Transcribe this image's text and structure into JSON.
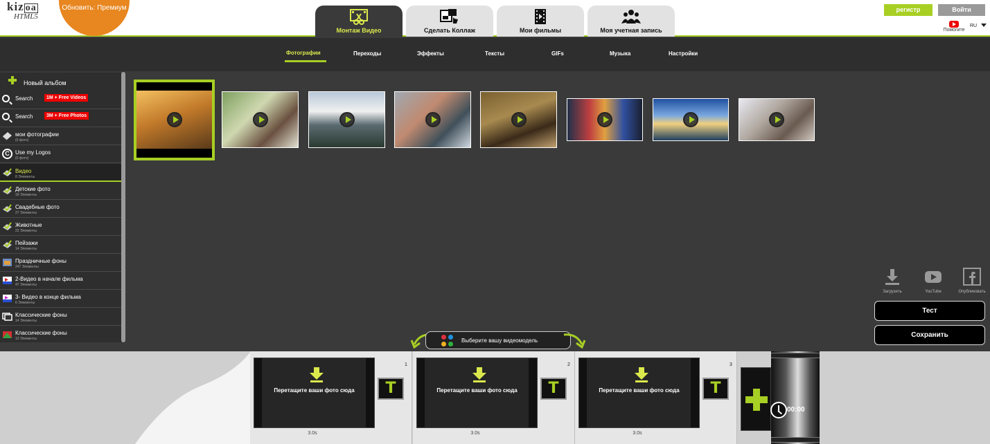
{
  "app": {
    "logo_main": "kizoa",
    "logo_sub": "HTML5",
    "premium_label": "Обновить: Премиум"
  },
  "tabs": [
    {
      "label": "Монтаж Видео",
      "icon": "film-scissors-icon",
      "active": true
    },
    {
      "label": "Сделать Коллаж",
      "icon": "collage-icon",
      "active": false
    },
    {
      "label": "Мои фильмы",
      "icon": "film-icon",
      "active": false
    },
    {
      "label": "Моя учетная запись",
      "icon": "users-icon",
      "active": false
    }
  ],
  "account": {
    "register_label": "регистр",
    "login_label": "Войти",
    "help_label": "Помогите",
    "language": "RU"
  },
  "subtabs": [
    {
      "label": "Фотографии",
      "active": true
    },
    {
      "label": "Переходы",
      "active": false
    },
    {
      "label": "Эффекты",
      "active": false
    },
    {
      "label": "Тексты",
      "active": false
    },
    {
      "label": "GIFs",
      "active": false
    },
    {
      "label": "Музыка",
      "active": false
    },
    {
      "label": "Настройки",
      "active": false
    }
  ],
  "sidebar": {
    "new_album_label": "Новый альбом",
    "items": [
      {
        "label": "Search",
        "badge": "1M + Free Videos",
        "icon": "search-icon"
      },
      {
        "label": "Search",
        "badge": "3M + Free Photos",
        "icon": "search-icon"
      },
      {
        "label": "мои фотографии",
        "count": "(0 фото)",
        "icon": "album-icon"
      },
      {
        "label": "Use my Logos",
        "count": "(0 фото)",
        "icon": "copyright-icon"
      },
      {
        "label": "Видео",
        "count": "8 Элементы",
        "icon": "folder-check-icon",
        "active": true
      },
      {
        "label": "Детские фото",
        "count": "18 Элементы",
        "icon": "folder-check-icon"
      },
      {
        "label": "Свадебные фото",
        "count": "27 Элементы",
        "icon": "folder-check-icon"
      },
      {
        "label": "Животные",
        "count": "22 Элементы",
        "icon": "folder-check-icon"
      },
      {
        "label": "Пейзажи",
        "count": "14 Элементы",
        "icon": "folder-check-icon"
      },
      {
        "label": "Праздничные фоны",
        "count": "247 Элементы",
        "icon": "holiday-icon"
      },
      {
        "label": "2-Видео в начале фильма",
        "count": "47 Элементы",
        "icon": "intro-video-icon"
      },
      {
        "label": "3- Видео в конце фильма",
        "count": "6 Элементы",
        "icon": "outro-video-icon"
      },
      {
        "label": "Классические фоны",
        "count": "14 Элементы",
        "icon": "classic-bg-icon"
      },
      {
        "label": "Классические фоны",
        "count": "13 Элементы",
        "icon": "classic-bg-color-icon"
      }
    ]
  },
  "share": [
    {
      "label": "Загрузить",
      "icon": "download-icon"
    },
    {
      "label": "YouTube",
      "icon": "youtube-icon"
    },
    {
      "label": "Опубликовать",
      "icon": "facebook-icon"
    }
  ],
  "actions": {
    "test_label": "Тест",
    "save_label": "Сохранить"
  },
  "model_picker": {
    "label": "Выберите вашу видеомодель"
  },
  "timeline": {
    "slots": [
      {
        "number": "1",
        "drop_label": "Перетащите ваши фото сюда",
        "duration": "3.0s",
        "text_button": "T"
      },
      {
        "number": "2",
        "drop_label": "Перетащите ваши фото сюда",
        "duration": "3.0s",
        "text_button": "T"
      },
      {
        "number": "3",
        "drop_label": "Перетащите ваши фото сюда",
        "duration": "3.0s",
        "text_button": "T"
      }
    ],
    "total_time": "00:00"
  },
  "colors": {
    "accent": "#a8cf24",
    "active_text": "#dbe94c",
    "premium": "#e8861f",
    "badge_red": "#e00000"
  }
}
